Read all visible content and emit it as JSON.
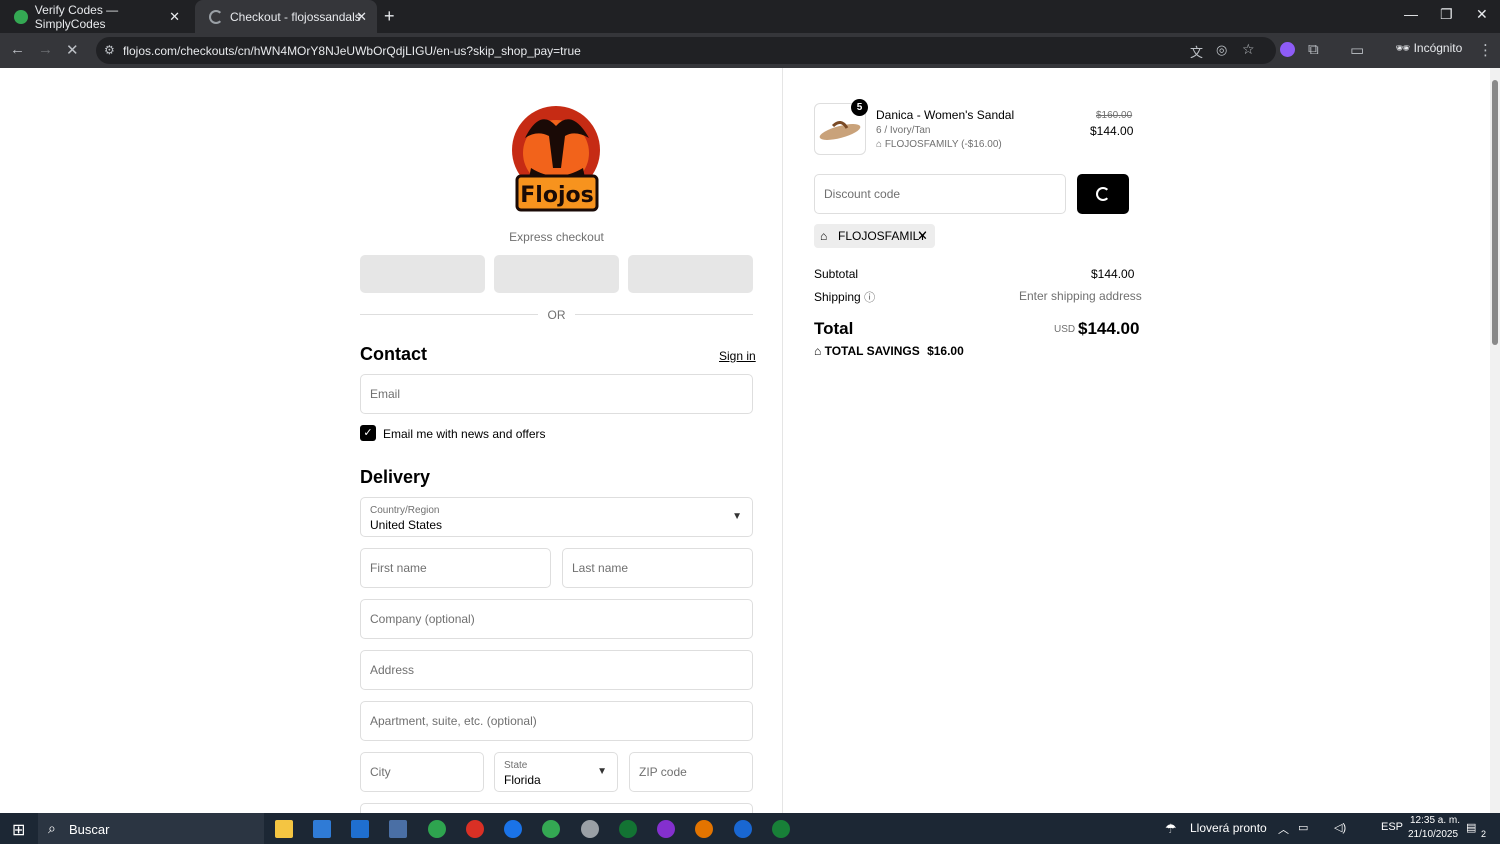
{
  "browser": {
    "tabs": [
      {
        "title": "Verify Codes — SimplyCodes",
        "active": false
      },
      {
        "title": "Checkout - flojossandals",
        "active": true
      }
    ],
    "url": "flojos.com/checkouts/cn/hWN4MOrY8NJeUWbOrQdjLIGU/en-us?skip_shop_pay=true",
    "profile_label": "Incógnito"
  },
  "checkout": {
    "express_label": "Express checkout",
    "or_label": "OR",
    "contact": {
      "heading": "Contact",
      "sign_in": "Sign in",
      "email_placeholder": "Email",
      "newsletter_label": "Email me with news and offers",
      "newsletter_checked": true
    },
    "delivery": {
      "heading": "Delivery",
      "country_label": "Country/Region",
      "country_value": "United States",
      "first_name_placeholder": "First name",
      "last_name_placeholder": "Last name",
      "company_placeholder": "Company (optional)",
      "address_placeholder": "Address",
      "apartment_placeholder": "Apartment, suite, etc. (optional)",
      "city_placeholder": "City",
      "state_label": "State",
      "state_value": "Florida",
      "zip_placeholder": "ZIP code"
    }
  },
  "summary": {
    "item": {
      "quantity": "5",
      "name": "Danica - Women's Sandal",
      "variant": "6 / Ivory/Tan",
      "discount": "FLOJOSFAMILY (-$16.00)",
      "original_price": "$160.00",
      "price": "$144.00"
    },
    "discount_placeholder": "Discount code",
    "applied_code": "FLOJOSFAMILY",
    "subtotal_label": "Subtotal",
    "subtotal_value": "$144.00",
    "shipping_label": "Shipping",
    "shipping_value": "Enter shipping address",
    "total_label": "Total",
    "currency": "USD",
    "total_value": "$144.00",
    "savings_label": "TOTAL SAVINGS",
    "savings_value": "$16.00"
  },
  "taskbar": {
    "search_label": "Buscar",
    "weather": "Lloverá pronto",
    "language": "ESP",
    "time": "12:35 a. m.",
    "date": "21/10/2025",
    "notifications": "2"
  },
  "colors": {
    "chrome_dark": "#202124",
    "chrome_tab": "#35363a",
    "button_black": "#000000",
    "taskbar": "#1c2734"
  }
}
